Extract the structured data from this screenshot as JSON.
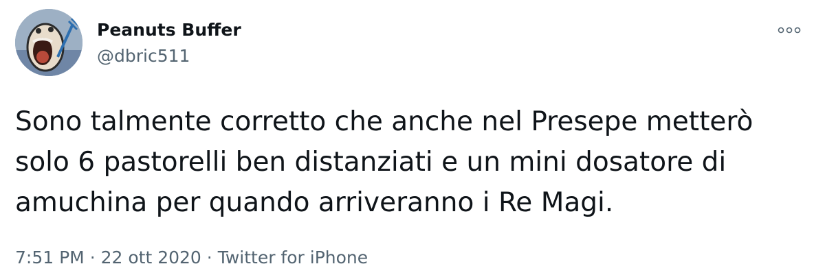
{
  "user": {
    "display_name": "Peanuts Buffer",
    "handle": "@dbric511",
    "avatar_icon": "screaming-face-avatar"
  },
  "more_icon": "more-options-icon",
  "tweet": {
    "text": "Sono talmente corretto che anche nel Presepe metterò\nsolo 6 pastorelli ben distanziati e un mini dosatore di\namuchina per quando arriveranno i Re Magi."
  },
  "meta": {
    "time": "7:51 PM",
    "separator": "·",
    "date": "22 ott 2020",
    "source": "Twitter for iPhone"
  },
  "colors": {
    "text": "#0f1419",
    "secondary": "#536471",
    "background": "#ffffff"
  }
}
